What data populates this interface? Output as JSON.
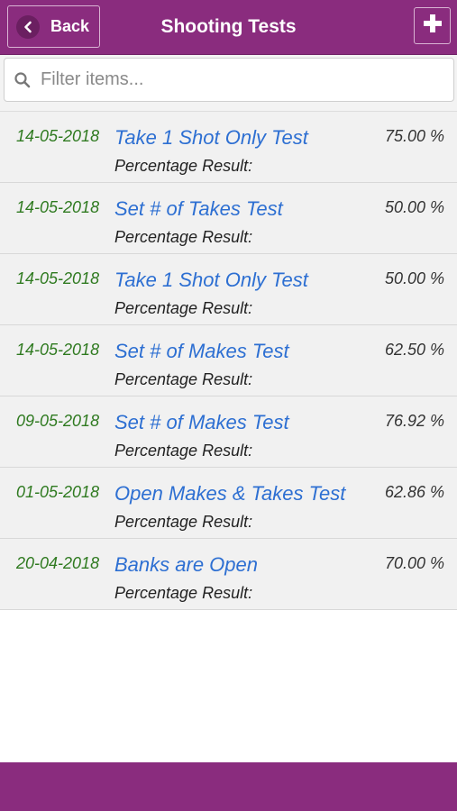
{
  "header": {
    "back_label": "Back",
    "title": "Shooting Tests",
    "back_icon": "chevron-left-icon",
    "add_icon": "plus-icon"
  },
  "search": {
    "placeholder": "Filter items...",
    "value": "",
    "icon": "search-icon"
  },
  "colors": {
    "brand": "#8a2c7e",
    "date": "#2f7a20",
    "link": "#2d6fd2"
  },
  "tests": [
    {
      "date": "14-05-2018",
      "name": "Take 1 Shot Only Test",
      "result_label": "Percentage Result:",
      "percent": "75.00 %"
    },
    {
      "date": "14-05-2018",
      "name": "Set # of Takes Test",
      "result_label": "Percentage Result:",
      "percent": "50.00 %"
    },
    {
      "date": "14-05-2018",
      "name": "Take 1 Shot Only Test",
      "result_label": "Percentage Result:",
      "percent": "50.00 %"
    },
    {
      "date": "14-05-2018",
      "name": "Set # of Makes Test",
      "result_label": "Percentage Result:",
      "percent": "62.50 %"
    },
    {
      "date": "09-05-2018",
      "name": "Set # of Makes Test",
      "result_label": "Percentage Result:",
      "percent": "76.92 %"
    },
    {
      "date": "01-05-2018",
      "name": "Open Makes & Takes Test",
      "result_label": "Percentage Result:",
      "percent": "62.86 %"
    },
    {
      "date": "20-04-2018",
      "name": "Banks are Open",
      "result_label": "Percentage Result:",
      "percent": "70.00 %"
    }
  ]
}
